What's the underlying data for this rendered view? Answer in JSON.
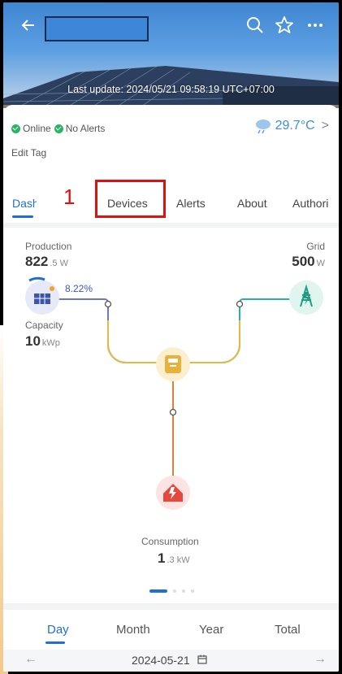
{
  "header": {
    "back_icon": "arrow-left-icon",
    "search_icon": "search-icon",
    "favorite_icon": "star-icon",
    "more_icon": "more-icon",
    "last_update": "Last update: 2024/05/21 09:58:19 UTC+07:00"
  },
  "status": {
    "online": "Online",
    "alerts": "No Alerts",
    "edit_tag": "Edit Tag",
    "weather_icon": "rain-cloud-icon",
    "temperature": "29.7°C",
    "temperature_chevron": ">"
  },
  "tabs": [
    "Dash",
    "Devices",
    "Alerts",
    "About",
    "Authori"
  ],
  "annotation": {
    "label": "1"
  },
  "energy": {
    "production_label": "Production",
    "production_value": "822",
    "production_unit": ".5 W",
    "percent": "8.22%",
    "capacity_label": "Capacity",
    "capacity_value": "10",
    "capacity_unit": "kWp",
    "grid_label": "Grid",
    "grid_value": "500",
    "grid_unit": "W",
    "consumption_label": "Consumption",
    "consumption_value": "1",
    "consumption_unit": ".3 kW"
  },
  "periods": [
    "Day",
    "Month",
    "Year",
    "Total"
  ],
  "date": {
    "value": "2024-05-21",
    "prev": "←",
    "next": "→",
    "calendar_icon": "calendar-icon"
  },
  "colors": {
    "accent": "#1e6fd9",
    "solar_line": "#6b78c9",
    "grid_line": "#2bb39a",
    "inverter_line": "#e7b74a",
    "load_line": "#e67e3a",
    "annotation": "#e01010"
  }
}
